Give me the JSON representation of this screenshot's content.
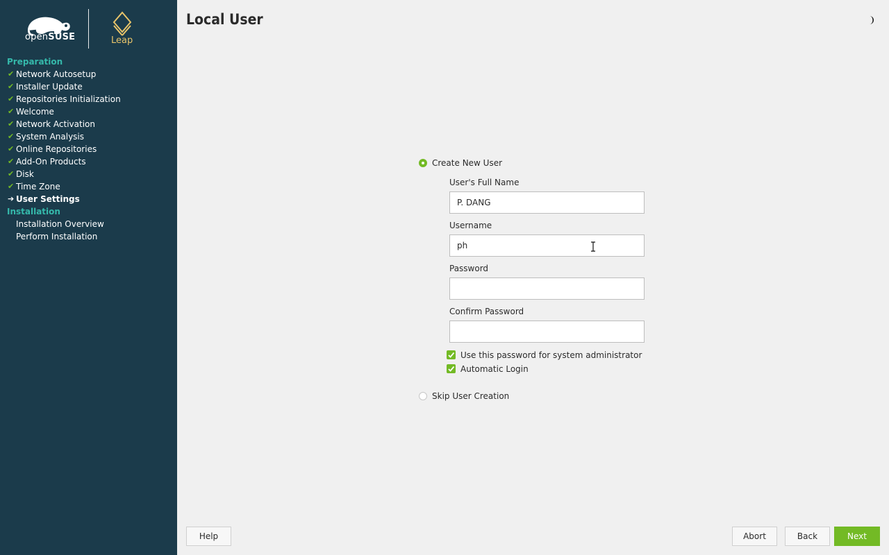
{
  "branding": {
    "opensuse_text_a": "open",
    "opensuse_text_b": "SUSE",
    "product": "Leap"
  },
  "sidebar": {
    "sections": [
      {
        "title": "Preparation"
      },
      {
        "title": "Installation"
      }
    ],
    "preparation_steps": [
      {
        "label": "Network Autosetup",
        "status": "done"
      },
      {
        "label": "Installer Update",
        "status": "done"
      },
      {
        "label": "Repositories Initialization",
        "status": "done"
      },
      {
        "label": "Welcome",
        "status": "done"
      },
      {
        "label": "Network Activation",
        "status": "done"
      },
      {
        "label": "System Analysis",
        "status": "done"
      },
      {
        "label": "Online Repositories",
        "status": "done"
      },
      {
        "label": "Add-On Products",
        "status": "done"
      },
      {
        "label": "Disk",
        "status": "done"
      },
      {
        "label": "Time Zone",
        "status": "done"
      },
      {
        "label": "User Settings",
        "status": "current"
      }
    ],
    "installation_steps": [
      {
        "label": "Installation Overview",
        "status": "pending"
      },
      {
        "label": "Perform Installation",
        "status": "pending"
      }
    ]
  },
  "page": {
    "title": "Local User"
  },
  "form": {
    "create_new_user_label": "Create New User",
    "full_name_label": "User's Full Name",
    "full_name_value": "P. DANG",
    "username_label": "Username",
    "username_value": "ph",
    "password_label": "Password",
    "password_value": "",
    "confirm_password_label": "Confirm Password",
    "confirm_password_value": "",
    "use_for_admin_label": "Use this password for system administrator",
    "use_for_admin_checked": true,
    "automatic_login_label": "Automatic Login",
    "automatic_login_checked": true,
    "skip_user_creation_label": "Skip User Creation",
    "selected_option": "create"
  },
  "buttons": {
    "help": "Help",
    "abort": "Abort",
    "back": "Back",
    "next": "Next"
  },
  "colors": {
    "sidebar_bg": "#1b3b4b",
    "section_title": "#35b9ab",
    "accent_green": "#73ba25",
    "leap_gold": "#e8c46a"
  }
}
